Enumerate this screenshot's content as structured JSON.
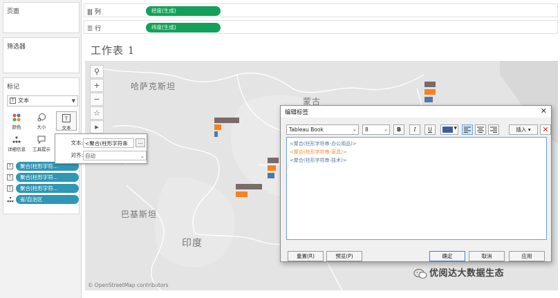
{
  "left_panel": {
    "pages_title": "页面",
    "filters_title": "筛选器",
    "marks_title": "标记",
    "mark_type": "文本",
    "mark_buttons": [
      {
        "label": "颜色",
        "icon": "color-dots-icon"
      },
      {
        "label": "大小",
        "icon": "size-icon"
      },
      {
        "label": "文本",
        "icon": "text-icon"
      },
      {
        "label": "详细信息",
        "icon": "detail-icon"
      },
      {
        "label": "工具提示",
        "icon": "tooltip-icon"
      }
    ],
    "mark_pills": [
      {
        "icon": "text-icon",
        "label": "聚合(柱形字符..."
      },
      {
        "icon": "text-icon",
        "label": "聚合(柱形字符..."
      },
      {
        "icon": "text-icon",
        "label": "聚合(柱形字符..."
      },
      {
        "icon": "detail-icon",
        "label": "省/自治区"
      }
    ]
  },
  "shelves": {
    "columns_label": "列",
    "columns_pill": "经度(生成)",
    "rows_label": "行",
    "rows_pill": "纬度(生成)"
  },
  "sheet_title": "工作表 1",
  "map": {
    "labels": [
      "哈萨克斯坦",
      "蒙古",
      "巴基斯坦",
      "印度"
    ],
    "credit": "© OpenStreetMap contributors",
    "tools": [
      "search-icon",
      "zoom-in-icon",
      "zoom-out-icon",
      "pin-icon",
      "pan-arrow-icon"
    ],
    "series_colors": {
      "dark": "#7a6a6a",
      "orange": "#f5821f",
      "blue": "#4e79a7"
    }
  },
  "text_popup": {
    "text_label": "文本:",
    "text_value": "<聚合(柱形字符串",
    "more_button": "...",
    "align_label": "对齐:",
    "align_value": "自动"
  },
  "dialog": {
    "title": "编辑标签",
    "font": "Tableau Book",
    "size": "8",
    "bold": "B",
    "italic": "I",
    "underline": "U",
    "font_color": "#3c5e9e",
    "insert": "插入",
    "lines": [
      {
        "text": "<聚合(柱形字符串-办公用品)>",
        "color": "#4e79a7"
      },
      {
        "text": "<聚合(柱形字符串-家具)>",
        "color": "#f28e2b"
      },
      {
        "text": "<聚合(柱形字符串-技术)>",
        "color": "#4e79a7"
      }
    ],
    "buttons": {
      "reset": "重置(R)",
      "preview": "预览(P)",
      "ok": "确定",
      "cancel": "取消",
      "apply": "应用"
    }
  },
  "watermark": "优阅达大数据生态"
}
